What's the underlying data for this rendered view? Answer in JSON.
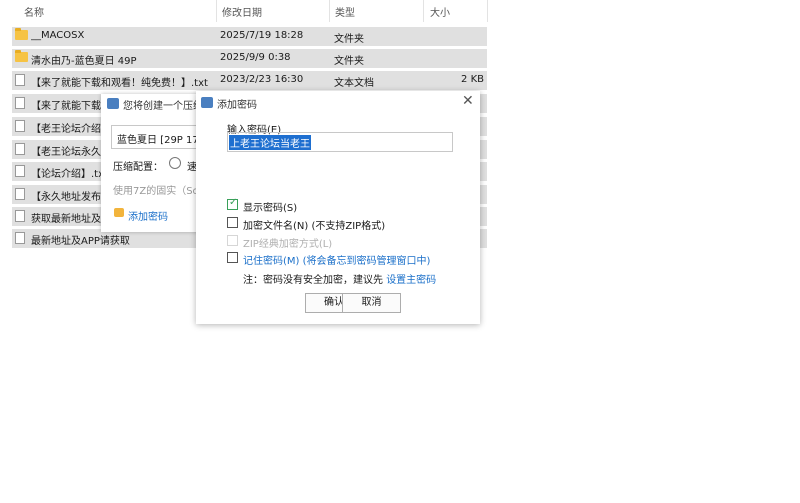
{
  "columns": {
    "name": "名称",
    "date": "修改日期",
    "type": "类型",
    "size": "大小"
  },
  "files": [
    {
      "name": "__MACOSX",
      "date": "2025/7/19 18:28",
      "type": "文件夹",
      "size": "",
      "icon": "folder-icon"
    },
    {
      "name": "清水由乃-蓝色夏日 49P",
      "date": "2025/9/9 0:38",
      "type": "文件夹",
      "size": "",
      "icon": "folder-icon"
    },
    {
      "name": "【来了就能下载和观看！纯免费！】.txt",
      "date": "2023/2/23 16:30",
      "type": "文本文档",
      "size": "2 KB",
      "icon": "document-icon"
    },
    {
      "name": "【来了就能下载和观看",
      "date": "",
      "type": "",
      "size": "",
      "icon": "document-icon"
    },
    {
      "name": "【老王论坛介绍】",
      "date": "",
      "type": "",
      "size": "",
      "icon": "document-icon"
    },
    {
      "name": "【老王论坛永久地",
      "date": "",
      "type": "",
      "size": "",
      "icon": "document-icon"
    },
    {
      "name": "【论坛介绍】.txt",
      "date": "",
      "type": "",
      "size": "",
      "icon": "document-icon"
    },
    {
      "name": "【永久地址发布页",
      "date": "",
      "type": "",
      "size": "",
      "icon": "document-icon"
    },
    {
      "name": "获取最新地址及APP",
      "date": "",
      "type": "",
      "size": "",
      "icon": "document-icon"
    },
    {
      "name": "最新地址及APP请获取",
      "date": "",
      "type": "",
      "size": "",
      "icon": "document-icon"
    }
  ],
  "back_dialog": {
    "title": "您将创建一个压缩",
    "archive_name": "蓝色夏日 [29P 170",
    "compress_label": "压缩配置：",
    "compress_option": "速",
    "hint": "使用7Z的固实（So",
    "add_password": "添加密码"
  },
  "password_dialog": {
    "title": "添加密码",
    "input_label": "输入密码(E)",
    "password_value": "上老王论坛当老王",
    "show_password": "显示密码(S)",
    "encrypt_filenames": "加密文件名(N) (不支持ZIP格式)",
    "zip_classic": "ZIP经典加密方式(L)",
    "remember_password": "记住密码(M) (将会备忘到密码管理窗口中)",
    "note_prefix": "注：密码没有安全加密，建议先 ",
    "note_link": "设置主密码",
    "ok": "确认",
    "cancel": "取消",
    "show_password_checked": true
  }
}
